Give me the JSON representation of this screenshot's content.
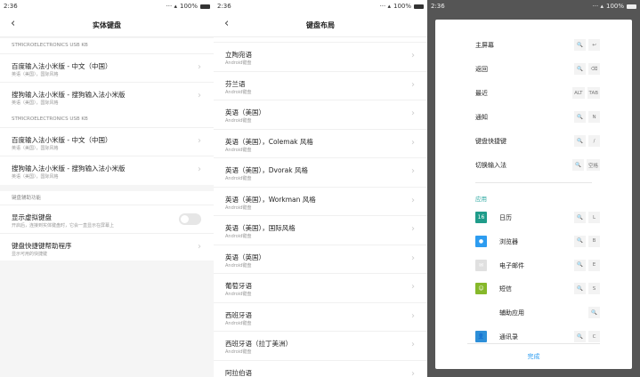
{
  "status": {
    "time": "2:36",
    "battery": "100%"
  },
  "panel1": {
    "title": "实体键盘",
    "sections": [
      {
        "label": "STMICROELECTRONICS USB KB",
        "items": [
          {
            "title": "百度输入法小米版 - 中文（中国）",
            "subtitle": "英语（美国），国际风格"
          },
          {
            "title": "搜狗输入法小米版 - 搜狗输入法小米版",
            "subtitle": "英语（美国），国际风格"
          }
        ]
      },
      {
        "label": "STMICROELECTRONICS USB KB",
        "items": [
          {
            "title": "百度输入法小米版 - 中文（中国）",
            "subtitle": "英语（美国），国际风格"
          },
          {
            "title": "搜狗输入法小米版 - 搜狗输入法小米版",
            "subtitle": "英语（美国），国际风格"
          }
        ]
      }
    ],
    "assist": {
      "label": "键盘辅助功能",
      "toggle": {
        "title": "显示虚拟键盘",
        "subtitle": "开启后，连接到实体键盘时，它会一直显示在屏幕上",
        "on": false
      },
      "helper": {
        "title": "键盘快捷键帮助程序",
        "subtitle": "显示可用的快捷键"
      }
    }
  },
  "panel2": {
    "title": "键盘布局",
    "items": [
      {
        "title": "立陶宛语",
        "subtitle": "Android键盘"
      },
      {
        "title": "芬兰语",
        "subtitle": "Android键盘"
      },
      {
        "title": "英语（美国）",
        "subtitle": "Android键盘"
      },
      {
        "title": "英语（美国），Colemak 风格",
        "subtitle": "Android键盘"
      },
      {
        "title": "英语（美国），Dvorak 风格",
        "subtitle": "Android键盘"
      },
      {
        "title": "英语（美国），Workman 风格",
        "subtitle": "Android键盘"
      },
      {
        "title": "英语（美国），国际风格",
        "subtitle": "Android键盘"
      },
      {
        "title": "英语（英国）",
        "subtitle": "Android键盘"
      },
      {
        "title": "葡萄牙语",
        "subtitle": "Android键盘"
      },
      {
        "title": "西班牙语",
        "subtitle": "Android键盘"
      },
      {
        "title": "西班牙语（拉丁美洲）",
        "subtitle": "Android键盘"
      },
      {
        "title": "阿拉伯语",
        "subtitle": ""
      }
    ]
  },
  "panel3": {
    "system": [
      {
        "label": "主屏幕",
        "keys": [
          "🔍",
          "↩"
        ]
      },
      {
        "label": "返回",
        "keys": [
          "🔍",
          "⌫"
        ]
      },
      {
        "label": "最近",
        "keys": [
          "ALT",
          "TAB"
        ]
      },
      {
        "label": "通知",
        "keys": [
          "🔍",
          "N"
        ]
      },
      {
        "label": "键盘快捷键",
        "keys": [
          "🔍",
          "/"
        ]
      },
      {
        "label": "切换输入法",
        "keys": [
          "🔍",
          "空格"
        ]
      }
    ],
    "apps_label": "应用",
    "apps": [
      {
        "label": "日历",
        "icon": "16",
        "color": "#1f9c8a",
        "keys": [
          "🔍",
          "L"
        ]
      },
      {
        "label": "浏览器",
        "icon": "●",
        "color": "#2d9cf0",
        "keys": [
          "🔍",
          "B"
        ]
      },
      {
        "label": "电子邮件",
        "icon": "✉",
        "color": "#e0e0e0",
        "keys": [
          "🔍",
          "E"
        ]
      },
      {
        "label": "短信",
        "icon": "☺",
        "color": "#86b82a",
        "keys": [
          "🔍",
          "S"
        ]
      },
      {
        "label": "辅助应用",
        "icon": "▲",
        "color": "#ffffff",
        "keys": [
          "🔍"
        ]
      },
      {
        "label": "通讯录",
        "icon": "👤",
        "color": "#2d8fd8",
        "keys": [
          "🔍",
          "C"
        ]
      }
    ],
    "done": "完成",
    "accent": "#2aa7a0",
    "link": "#2d9cf0"
  }
}
